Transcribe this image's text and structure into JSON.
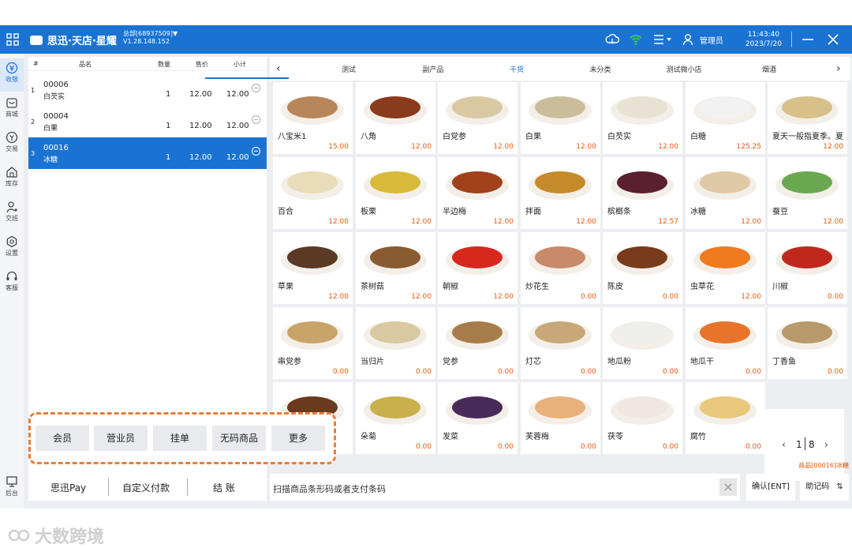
{
  "header": {
    "brand": "思迅·天店·星耀",
    "store_line1": "总部[68937509]▼",
    "store_line2": "V1.28.148.152",
    "user": "管理员",
    "time": "11:43:40",
    "date": "2023/7/20"
  },
  "sidebar": {
    "items": [
      {
        "label": "收银",
        "icon": "cashier-icon"
      },
      {
        "label": "商城",
        "icon": "mall-icon"
      },
      {
        "label": "交易",
        "icon": "trade-icon"
      },
      {
        "label": "库存",
        "icon": "inventory-icon"
      },
      {
        "label": "交班",
        "icon": "shift-icon"
      },
      {
        "label": "设置",
        "icon": "gear-icon"
      },
      {
        "label": "客服",
        "icon": "headset-icon"
      }
    ],
    "backend": "后台"
  },
  "order": {
    "columns": [
      "#",
      "品名",
      "数量",
      "售价",
      "小计"
    ],
    "rows": [
      {
        "idx": "1",
        "code": "00006",
        "name": "白芡实",
        "qty": "1",
        "price": "12.00",
        "subtotal": "12.00"
      },
      {
        "idx": "2",
        "code": "00004",
        "name": "白果",
        "qty": "1",
        "price": "12.00",
        "subtotal": "12.00"
      },
      {
        "idx": "3",
        "code": "00016",
        "name": "冰糖",
        "qty": "1",
        "price": "12.00",
        "subtotal": "12.00"
      }
    ]
  },
  "functions": [
    "会员",
    "营业员",
    "挂单",
    "无码商品",
    "更多"
  ],
  "payment": [
    "思迅Pay",
    "自定义付款",
    "结 账"
  ],
  "tabs": [
    "测试",
    "副产品",
    "干货",
    "未分类",
    "测试微小店",
    "烟酒"
  ],
  "products": [
    {
      "name": "八宝米1",
      "price": "15.00",
      "color": "#b8865a"
    },
    {
      "name": "八角",
      "price": "12.00",
      "color": "#8a3b1c"
    },
    {
      "name": "白党参",
      "price": "12.00",
      "color": "#d9c9a3"
    },
    {
      "name": "白果",
      "price": "12.00",
      "color": "#cbbd9c"
    },
    {
      "name": "白芡实",
      "price": "12.00",
      "color": "#e8e2d4"
    },
    {
      "name": "白糖",
      "price": "125.25",
      "color": "#f2f2f2"
    },
    {
      "name": "夏天一般指夏季。夏",
      "price": "12.00",
      "color": "#d8c08a"
    },
    {
      "name": "百合",
      "price": "12.00",
      "color": "#e9dcb8"
    },
    {
      "name": "板栗",
      "price": "12.00",
      "color": "#d8b93a"
    },
    {
      "name": "半边梅",
      "price": "12.00",
      "color": "#a0421c"
    },
    {
      "name": "拌面",
      "price": "12.00",
      "color": "#c58a2a"
    },
    {
      "name": "槟榔条",
      "price": "12.57",
      "color": "#5a2030"
    },
    {
      "name": "冰糖",
      "price": "12.00",
      "color": "#e0c9a6"
    },
    {
      "name": "蚕豆",
      "price": "12.00",
      "color": "#6aa84f"
    },
    {
      "name": "草果",
      "price": "12.00",
      "color": "#5a3a24"
    },
    {
      "name": "茶树菇",
      "price": "12.00",
      "color": "#8a5a30"
    },
    {
      "name": "朝椒",
      "price": "12.00",
      "color": "#d8281e"
    },
    {
      "name": "炒花生",
      "price": "0.00",
      "color": "#c98a6a"
    },
    {
      "name": "陈皮",
      "price": "0.00",
      "color": "#7a3a1c"
    },
    {
      "name": "虫草花",
      "price": "12.00",
      "color": "#f07a1e"
    },
    {
      "name": "川椒",
      "price": "0.00",
      "color": "#c0281e"
    },
    {
      "name": "串党参",
      "price": "0.00",
      "color": "#c9a46a"
    },
    {
      "name": "当归片",
      "price": "0.00",
      "color": "#d9c9a0"
    },
    {
      "name": "党参",
      "price": "0.00",
      "color": "#a67c4a"
    },
    {
      "name": "灯芯",
      "price": "0.00",
      "color": "#c8a878"
    },
    {
      "name": "地瓜粉",
      "price": "0.00",
      "color": "#eeeeea"
    },
    {
      "name": "地瓜干",
      "price": "0.00",
      "color": "#e8742a"
    },
    {
      "name": "丁香鱼",
      "price": "0.00",
      "color": "#b89a6a"
    },
    {
      "name": "",
      "price": "",
      "color": "#6a3a1e"
    },
    {
      "name": "朵菊",
      "price": "0.00",
      "color": "#c9b04a"
    },
    {
      "name": "发菜",
      "price": "0.00",
      "color": "#4a2a5a"
    },
    {
      "name": "芙蓉梅",
      "price": "0.00",
      "color": "#e8b07a"
    },
    {
      "name": "茯苓",
      "price": "0.00",
      "color": "#f0e8e0"
    },
    {
      "name": "腐竹",
      "price": "0.00",
      "color": "#e8c87a"
    }
  ],
  "pager": {
    "current": "1",
    "total": "8"
  },
  "status": "商品[00016]冰糖",
  "scan": {
    "placeholder": "扫描商品条形码或者支付条码"
  },
  "confirm": "确认[ENT]",
  "memo": "助记码",
  "watermark": "大数跨境"
}
